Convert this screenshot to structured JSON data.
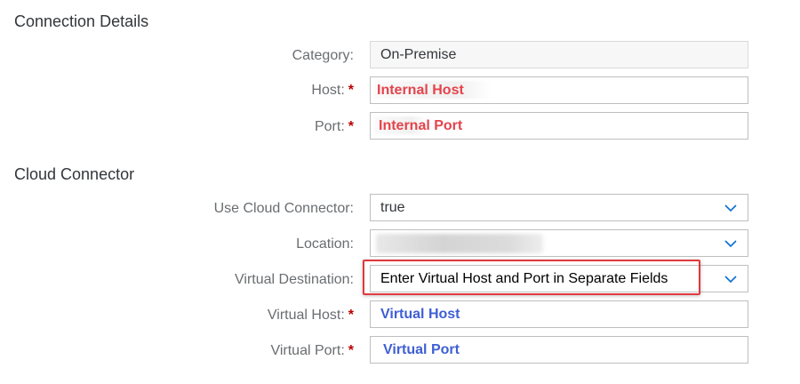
{
  "connection_details": {
    "title": "Connection Details",
    "category": {
      "label": "Category:",
      "value": "On-Premise"
    },
    "host": {
      "label": "Host:",
      "required_mark": "*",
      "value": "Internal Host"
    },
    "port": {
      "label": "Port:",
      "required_mark": "*",
      "value": "Internal Port"
    }
  },
  "cloud_connector": {
    "title": "Cloud Connector",
    "use_cloud_connector": {
      "label": "Use Cloud Connector:",
      "value": "true"
    },
    "location": {
      "label": "Location:",
      "value": ""
    },
    "virtual_destination": {
      "label": "Virtual Destination:",
      "value": "Enter Virtual Host and Port in Separate Fields"
    },
    "virtual_host": {
      "label": "Virtual Host:",
      "required_mark": "*",
      "value": "Virtual Host"
    },
    "virtual_port": {
      "label": "Virtual Port:",
      "required_mark": "*",
      "value": "Virtual Port"
    }
  },
  "colors": {
    "required": "#bb0000",
    "annotation_red": "#e5434b",
    "annotation_blue": "#3f5fd4",
    "chevron": "#0a6ed1"
  },
  "icons": {
    "dropdown": "chevron-down-icon"
  }
}
